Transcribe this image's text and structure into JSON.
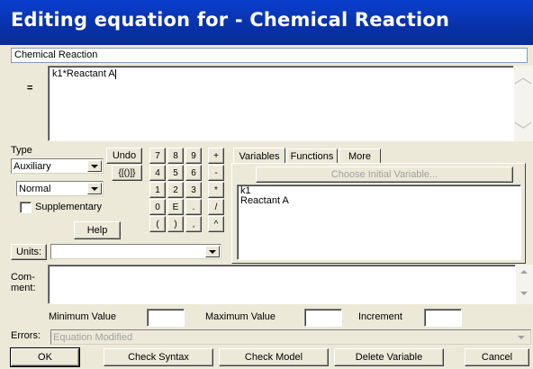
{
  "window": {
    "title": "Editing equation for - Chemical Reaction"
  },
  "variable_name": "Chemical Reaction",
  "equals_sign": "=",
  "equation": "k1*Reactant A",
  "type_section": {
    "label": "Type",
    "type_value": "Auxiliary",
    "subtype_value": "Normal",
    "supplementary_label": "Supplementary",
    "supplementary_checked": false,
    "help_label": "Help"
  },
  "undo_label": "Undo",
  "brackets_label": "{[()]}",
  "keypad": [
    [
      "7",
      "8",
      "9",
      "+"
    ],
    [
      "4",
      "5",
      "6",
      "-"
    ],
    [
      "1",
      "2",
      "3",
      "*"
    ],
    [
      "0",
      "E",
      ".",
      "/"
    ],
    [
      "(",
      ")",
      ",",
      "^"
    ]
  ],
  "tabs": {
    "variables": "Variables",
    "functions": "Functions",
    "more": "More"
  },
  "choose_initial_label": "Choose Initial Variable...",
  "variables_list": [
    "k1",
    "Reactant A"
  ],
  "units": {
    "label": "Units:",
    "value": ""
  },
  "comment_label": "Com-\nment:",
  "range": {
    "min_label": "Minimum Value",
    "max_label": "Maximum Value",
    "increment_label": "Increment",
    "min_value": "",
    "max_value": "",
    "increment_value": ""
  },
  "errors": {
    "label": "Errors:",
    "value": "Equation Modified"
  },
  "buttons": {
    "ok": "OK",
    "check_syntax": "Check Syntax",
    "check_model": "Check Model",
    "delete_variable": "Delete Variable",
    "cancel": "Cancel"
  },
  "colors": {
    "title_bar": "#0831a8",
    "dialog_bg": "#ece9d8"
  }
}
